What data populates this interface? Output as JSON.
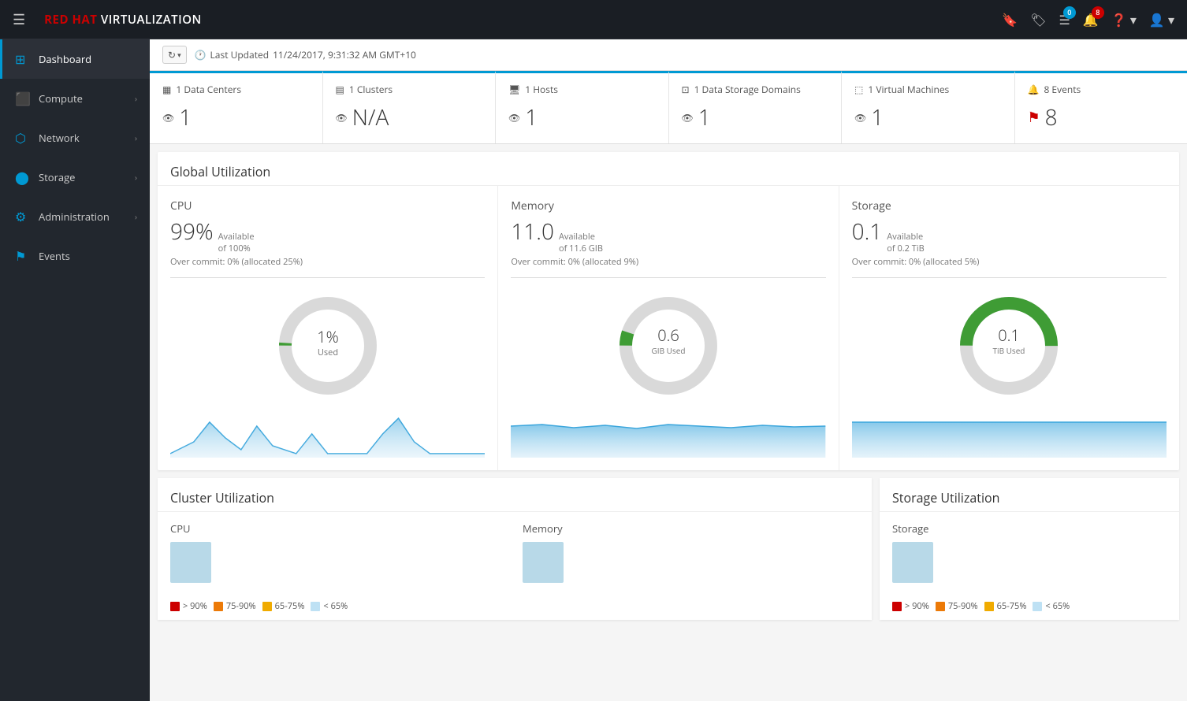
{
  "app": {
    "title": "RED HAT VIRTUALIZATION",
    "title_red": "RED HAT",
    "title_white": " VIRTUALIZATION"
  },
  "topnav": {
    "bookmark_badge": "",
    "tags_badge": "",
    "tasks_badge": "0",
    "notifications_badge": "8",
    "help_label": "?",
    "user_label": "👤"
  },
  "sidebar": {
    "items": [
      {
        "id": "dashboard",
        "label": "Dashboard",
        "icon": "⊞",
        "active": true,
        "arrow": false
      },
      {
        "id": "compute",
        "label": "Compute",
        "icon": "⬛",
        "active": false,
        "arrow": true
      },
      {
        "id": "network",
        "label": "Network",
        "icon": "⬡",
        "active": false,
        "arrow": true
      },
      {
        "id": "storage",
        "label": "Storage",
        "icon": "⬤",
        "active": false,
        "arrow": true
      },
      {
        "id": "administration",
        "label": "Administration",
        "icon": "⚙",
        "active": false,
        "arrow": true
      },
      {
        "id": "events",
        "label": "Events",
        "icon": "⚑",
        "active": false,
        "arrow": false
      }
    ]
  },
  "header": {
    "last_updated_label": "Last Updated",
    "last_updated_value": "11/24/2017, 9:31:32 AM GMT+10"
  },
  "summary_cards": [
    {
      "id": "datacenters",
      "icon": "▦",
      "title": "1 Data Centers",
      "count": "1",
      "count_type": "eye"
    },
    {
      "id": "clusters",
      "icon": "▤",
      "title": "1 Clusters",
      "count": "N/A",
      "count_type": "eye"
    },
    {
      "id": "hosts",
      "icon": "🖥",
      "title": "1 Hosts",
      "count": "1",
      "count_type": "eye"
    },
    {
      "id": "datastorage",
      "icon": "⬚",
      "title": "1 Data Storage Domains",
      "count": "1",
      "count_type": "eye"
    },
    {
      "id": "vms",
      "icon": "⬚",
      "title": "1 Virtual Machines",
      "count": "1",
      "count_type": "eye"
    },
    {
      "id": "events",
      "icon": "🔔",
      "title": "8 Events",
      "count": "8",
      "count_type": "flag"
    }
  ],
  "global_utilization": {
    "title": "Global Utilization",
    "columns": [
      {
        "id": "cpu",
        "title": "CPU",
        "available_num": "99%",
        "available_label": "Available",
        "available_sub": "of 100%",
        "overcommit": "Over commit: 0% (allocated 25%)",
        "donut_pct": 1,
        "donut_color": "#3f9c35",
        "donut_bg": "#d9d9d9",
        "center_num": "1%",
        "center_label": "Used"
      },
      {
        "id": "memory",
        "title": "Memory",
        "available_num": "11.0",
        "available_label": "Available",
        "available_sub": "of 11.6 GIB",
        "overcommit": "Over commit: 0% (allocated 9%)",
        "donut_pct": 5,
        "donut_color": "#3f9c35",
        "donut_bg": "#d9d9d9",
        "center_num": "0.6",
        "center_label": "GIB Used"
      },
      {
        "id": "storage",
        "title": "Storage",
        "available_num": "0.1",
        "available_label": "Available",
        "available_sub": "of 0.2 TiB",
        "overcommit": "Over commit: 0% (allocated 5%)",
        "donut_pct": 50,
        "donut_color": "#3f9c35",
        "donut_bg": "#d9d9d9",
        "center_num": "0.1",
        "center_label": "TiB Used"
      }
    ]
  },
  "cluster_utilization": {
    "title": "Cluster Utilization",
    "cpu_title": "CPU",
    "memory_title": "Memory"
  },
  "storage_utilization": {
    "title": "Storage Utilization",
    "storage_title": "Storage"
  },
  "legend": {
    "items": [
      {
        "color": "red",
        "label": "> 90%"
      },
      {
        "color": "orange",
        "label": "75-90%"
      },
      {
        "color": "yellow",
        "label": "65-75%"
      },
      {
        "color": "blue",
        "label": "< 65%"
      }
    ]
  }
}
